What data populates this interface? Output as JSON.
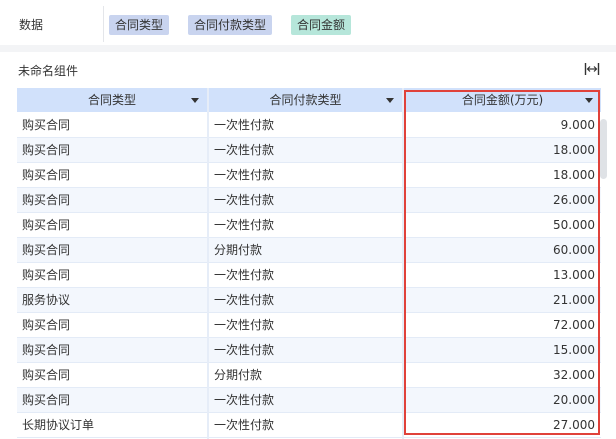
{
  "data_bar": {
    "label": "数据",
    "chips": [
      {
        "text": "合同类型",
        "kind": "dimension"
      },
      {
        "text": "合同付款类型",
        "kind": "dimension"
      },
      {
        "text": "合同金额",
        "kind": "measure"
      }
    ]
  },
  "widget": {
    "title": "未命名组件",
    "expand_icon": "fit-width-icon"
  },
  "table": {
    "columns": [
      {
        "label": "合同类型",
        "sort_icon": "caret-down-icon"
      },
      {
        "label": "合同付款类型",
        "sort_icon": "caret-down-icon"
      },
      {
        "label": "合同金额(万元)",
        "sort_icon": "caret-down-icon"
      }
    ],
    "rows": [
      [
        "购买合同",
        "一次性付款",
        "9.000"
      ],
      [
        "购买合同",
        "一次性付款",
        "18.000"
      ],
      [
        "购买合同",
        "一次性付款",
        "18.000"
      ],
      [
        "购买合同",
        "一次性付款",
        "26.000"
      ],
      [
        "购买合同",
        "一次性付款",
        "50.000"
      ],
      [
        "购买合同",
        "分期付款",
        "60.000"
      ],
      [
        "购买合同",
        "一次性付款",
        "13.000"
      ],
      [
        "服务协议",
        "一次性付款",
        "21.000"
      ],
      [
        "购买合同",
        "一次性付款",
        "72.000"
      ],
      [
        "购买合同",
        "一次性付款",
        "15.000"
      ],
      [
        "购买合同",
        "分期付款",
        "32.000"
      ],
      [
        "购买合同",
        "一次性付款",
        "20.000"
      ],
      [
        "长期协议订单",
        "一次性付款",
        "27.000"
      ]
    ]
  },
  "colors": {
    "header_bg": "#d1e1fb",
    "chip_dimension": "#c9d4ef",
    "chip_measure": "#b6e6da",
    "highlight_border": "#e0413a"
  }
}
